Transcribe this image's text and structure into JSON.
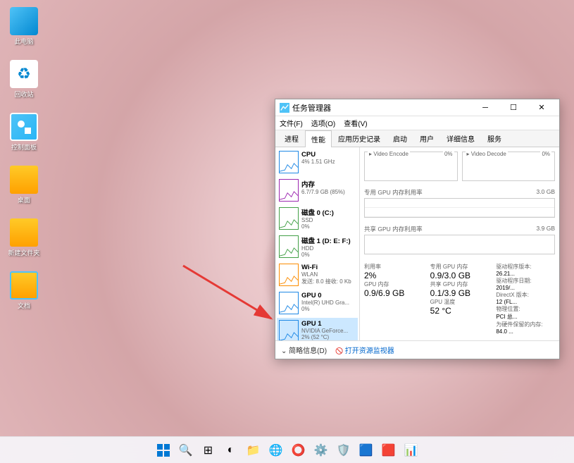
{
  "desktop_icons": [
    {
      "label": "此电脑",
      "type": "pc"
    },
    {
      "label": "回收站",
      "type": "bin"
    },
    {
      "label": "控制面板",
      "type": "app"
    },
    {
      "label": "桌面",
      "type": "folder"
    },
    {
      "label": "新建文件夹",
      "type": "folder"
    },
    {
      "label": "文档",
      "type": "folder"
    }
  ],
  "window": {
    "title": "任务管理器",
    "menu": [
      "文件(F)",
      "选项(O)",
      "查看(V)"
    ],
    "tabs": [
      "进程",
      "性能",
      "应用历史记录",
      "启动",
      "用户",
      "详细信息",
      "服务"
    ],
    "active_tab": 1
  },
  "resources": [
    {
      "name": "CPU",
      "sub": "4% 1.51 GHz",
      "color": "#1e88e5"
    },
    {
      "name": "内存",
      "sub": "6.7/7.9 GB (85%)",
      "color": "#9c27b0"
    },
    {
      "name": "磁盘 0 (C:)",
      "sub": "SSD\n0%",
      "color": "#43a047"
    },
    {
      "name": "磁盘 1 (D: E: F:)",
      "sub": "HDD\n0%",
      "color": "#43a047"
    },
    {
      "name": "Wi-Fi",
      "sub": "WLAN\n发送: 8.0 接收: 0 Kb",
      "color": "#fb8c00"
    },
    {
      "name": "GPU 0",
      "sub": "Intel(R) UHD Gra...\n0%",
      "color": "#1e88e5"
    },
    {
      "name": "GPU 1",
      "sub": "NVIDIA GeForce...\n2% (52 °C)",
      "color": "#1e88e5",
      "selected": true
    }
  ],
  "detail": {
    "encoders": [
      {
        "label": "Video Encode",
        "pct": "0%"
      },
      {
        "label": "Video Decode",
        "pct": "0%"
      }
    ],
    "mem_sections": [
      {
        "label": "专用 GPU 内存利用率",
        "max": "3.0 GB"
      },
      {
        "label": "共享 GPU 内存利用率",
        "max": "3.9 GB"
      }
    ],
    "stats_left": [
      {
        "lbl": "利用率",
        "val": "2%"
      },
      {
        "lbl": "GPU 内存",
        "val": "0.9/6.9 GB"
      }
    ],
    "stats_mid": [
      {
        "lbl": "专用 GPU 内存",
        "val": "0.9/3.0 GB"
      },
      {
        "lbl": "共享 GPU 内存",
        "val": "0.1/3.9 GB"
      },
      {
        "lbl": "GPU 温度",
        "val": "52 °C"
      }
    ],
    "stats_right": [
      {
        "lbl": "驱动程序版本:",
        "val": "26.21..."
      },
      {
        "lbl": "驱动程序日期:",
        "val": "2019/..."
      },
      {
        "lbl": "DirectX 版本:",
        "val": "12 (FL..."
      },
      {
        "lbl": "物理位置:",
        "val": "PCI 总..."
      },
      {
        "lbl": "为硬件保留的内存:",
        "val": "84.0 ..."
      }
    ]
  },
  "bottom": {
    "expand": "简略信息(D)",
    "link": "打开资源监视器"
  }
}
